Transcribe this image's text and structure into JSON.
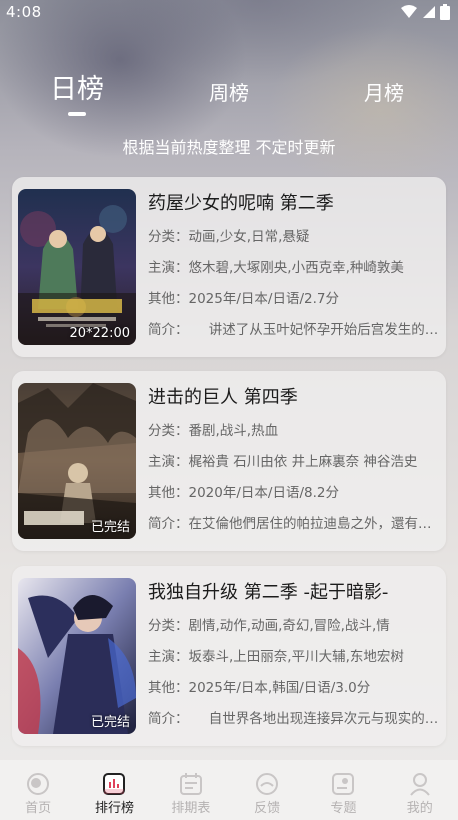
{
  "status": {
    "time": "4:08"
  },
  "tabs": [
    {
      "label": "日榜",
      "active": true
    },
    {
      "label": "周榜",
      "active": false
    },
    {
      "label": "月榜",
      "active": false
    }
  ],
  "subtitle": "根据当前热度整理 不定时更新",
  "items": [
    {
      "title": "药屋少女的呢喃 第二季",
      "category_label": "分类：",
      "category": "动画,少女,日常,悬疑",
      "cast_label": "主演：",
      "cast": "悠木碧,大塚刚央,小西克幸,种崎敦美",
      "other_label": "其他：",
      "other": "2025年/日本/日语/2.7分",
      "intro_label": "简介：",
      "intro": "　　讲述了从玉叶妃怀孕开始后宫发生的种种",
      "badge": "20*22:00"
    },
    {
      "title": "进击的巨人 第四季",
      "category_label": "分类：",
      "category": "番剧,战斗,热血",
      "cast_label": "主演：",
      "cast": "梶裕貴 石川由依 井上麻裏奈 神谷浩史",
      "other_label": "其他：",
      "other": "2020年/日本/日语/8.2分",
      "intro_label": "简介：",
      "intro": "在艾倫他們居住的帕拉迪島之外，還有更大的世界",
      "badge": "已完结"
    },
    {
      "title": "我独自升级 第二季 -起于暗影-",
      "category_label": "分类：",
      "category": "剧情,动作,动画,奇幻,冒险,战斗,情",
      "cast_label": "主演：",
      "cast": "坂泰斗,上田丽奈,平川大辅,东地宏树",
      "other_label": "其他：",
      "other": "2025年/日本,韩国/日语/3.0分",
      "intro_label": "简介：",
      "intro": "　　自世界各地出现连接异次元与现实的通道",
      "badge": "已完结"
    }
  ],
  "nav": [
    {
      "label": "首页",
      "icon": "home-icon",
      "active": false
    },
    {
      "label": "排行榜",
      "icon": "ranking-icon",
      "active": true
    },
    {
      "label": "排期表",
      "icon": "calendar-icon",
      "active": false
    },
    {
      "label": "反馈",
      "icon": "feedback-icon",
      "active": false
    },
    {
      "label": "专题",
      "icon": "topic-icon",
      "active": false
    },
    {
      "label": "我的",
      "icon": "profile-icon",
      "active": false
    }
  ],
  "colors": {
    "accent": "#e0415a",
    "nav_inactive": "#b5b2b2",
    "nav_active": "#222222"
  }
}
